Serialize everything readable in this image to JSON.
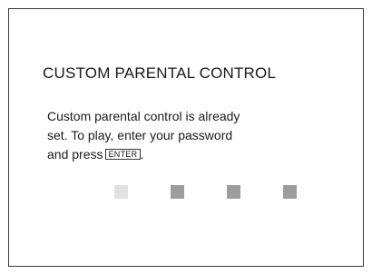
{
  "screen": {
    "title": "CUSTOM PARENTAL CONTROL",
    "message": {
      "line1": "Custom parental control is already",
      "line2": "set. To play, enter your password",
      "line3_prefix": "and press",
      "enter_key_label": "ENTER",
      "line3_suffix": "."
    }
  },
  "password_entry": {
    "digit_slots": 4,
    "active_slot": 1,
    "colors": {
      "active": "#e2e2e2",
      "inactive": "#9d9d9d",
      "frame": "#3a3a3a"
    }
  }
}
